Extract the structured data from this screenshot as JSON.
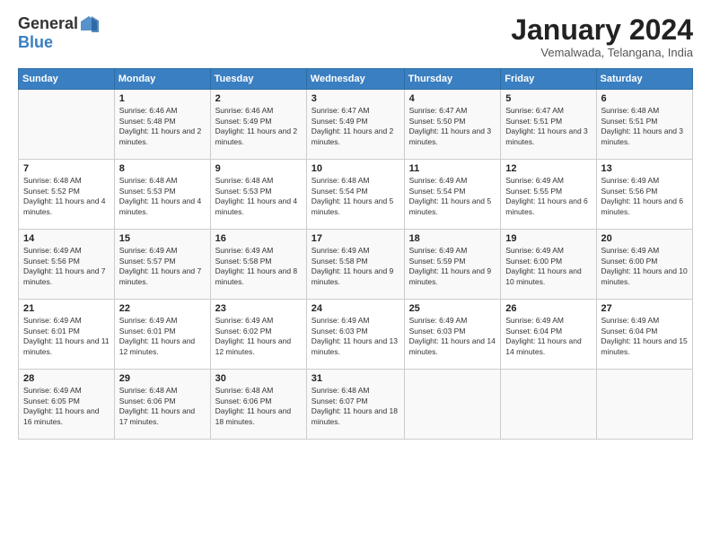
{
  "header": {
    "logo_general": "General",
    "logo_blue": "Blue",
    "month_title": "January 2024",
    "subtitle": "Vemalwada, Telangana, India"
  },
  "columns": [
    "Sunday",
    "Monday",
    "Tuesday",
    "Wednesday",
    "Thursday",
    "Friday",
    "Saturday"
  ],
  "weeks": [
    [
      {
        "day": "",
        "sunrise": "",
        "sunset": "",
        "daylight": ""
      },
      {
        "day": "1",
        "sunrise": "Sunrise: 6:46 AM",
        "sunset": "Sunset: 5:48 PM",
        "daylight": "Daylight: 11 hours and 2 minutes."
      },
      {
        "day": "2",
        "sunrise": "Sunrise: 6:46 AM",
        "sunset": "Sunset: 5:49 PM",
        "daylight": "Daylight: 11 hours and 2 minutes."
      },
      {
        "day": "3",
        "sunrise": "Sunrise: 6:47 AM",
        "sunset": "Sunset: 5:49 PM",
        "daylight": "Daylight: 11 hours and 2 minutes."
      },
      {
        "day": "4",
        "sunrise": "Sunrise: 6:47 AM",
        "sunset": "Sunset: 5:50 PM",
        "daylight": "Daylight: 11 hours and 3 minutes."
      },
      {
        "day": "5",
        "sunrise": "Sunrise: 6:47 AM",
        "sunset": "Sunset: 5:51 PM",
        "daylight": "Daylight: 11 hours and 3 minutes."
      },
      {
        "day": "6",
        "sunrise": "Sunrise: 6:48 AM",
        "sunset": "Sunset: 5:51 PM",
        "daylight": "Daylight: 11 hours and 3 minutes."
      }
    ],
    [
      {
        "day": "7",
        "sunrise": "Sunrise: 6:48 AM",
        "sunset": "Sunset: 5:52 PM",
        "daylight": "Daylight: 11 hours and 4 minutes."
      },
      {
        "day": "8",
        "sunrise": "Sunrise: 6:48 AM",
        "sunset": "Sunset: 5:53 PM",
        "daylight": "Daylight: 11 hours and 4 minutes."
      },
      {
        "day": "9",
        "sunrise": "Sunrise: 6:48 AM",
        "sunset": "Sunset: 5:53 PM",
        "daylight": "Daylight: 11 hours and 4 minutes."
      },
      {
        "day": "10",
        "sunrise": "Sunrise: 6:48 AM",
        "sunset": "Sunset: 5:54 PM",
        "daylight": "Daylight: 11 hours and 5 minutes."
      },
      {
        "day": "11",
        "sunrise": "Sunrise: 6:49 AM",
        "sunset": "Sunset: 5:54 PM",
        "daylight": "Daylight: 11 hours and 5 minutes."
      },
      {
        "day": "12",
        "sunrise": "Sunrise: 6:49 AM",
        "sunset": "Sunset: 5:55 PM",
        "daylight": "Daylight: 11 hours and 6 minutes."
      },
      {
        "day": "13",
        "sunrise": "Sunrise: 6:49 AM",
        "sunset": "Sunset: 5:56 PM",
        "daylight": "Daylight: 11 hours and 6 minutes."
      }
    ],
    [
      {
        "day": "14",
        "sunrise": "Sunrise: 6:49 AM",
        "sunset": "Sunset: 5:56 PM",
        "daylight": "Daylight: 11 hours and 7 minutes."
      },
      {
        "day": "15",
        "sunrise": "Sunrise: 6:49 AM",
        "sunset": "Sunset: 5:57 PM",
        "daylight": "Daylight: 11 hours and 7 minutes."
      },
      {
        "day": "16",
        "sunrise": "Sunrise: 6:49 AM",
        "sunset": "Sunset: 5:58 PM",
        "daylight": "Daylight: 11 hours and 8 minutes."
      },
      {
        "day": "17",
        "sunrise": "Sunrise: 6:49 AM",
        "sunset": "Sunset: 5:58 PM",
        "daylight": "Daylight: 11 hours and 9 minutes."
      },
      {
        "day": "18",
        "sunrise": "Sunrise: 6:49 AM",
        "sunset": "Sunset: 5:59 PM",
        "daylight": "Daylight: 11 hours and 9 minutes."
      },
      {
        "day": "19",
        "sunrise": "Sunrise: 6:49 AM",
        "sunset": "Sunset: 6:00 PM",
        "daylight": "Daylight: 11 hours and 10 minutes."
      },
      {
        "day": "20",
        "sunrise": "Sunrise: 6:49 AM",
        "sunset": "Sunset: 6:00 PM",
        "daylight": "Daylight: 11 hours and 10 minutes."
      }
    ],
    [
      {
        "day": "21",
        "sunrise": "Sunrise: 6:49 AM",
        "sunset": "Sunset: 6:01 PM",
        "daylight": "Daylight: 11 hours and 11 minutes."
      },
      {
        "day": "22",
        "sunrise": "Sunrise: 6:49 AM",
        "sunset": "Sunset: 6:01 PM",
        "daylight": "Daylight: 11 hours and 12 minutes."
      },
      {
        "day": "23",
        "sunrise": "Sunrise: 6:49 AM",
        "sunset": "Sunset: 6:02 PM",
        "daylight": "Daylight: 11 hours and 12 minutes."
      },
      {
        "day": "24",
        "sunrise": "Sunrise: 6:49 AM",
        "sunset": "Sunset: 6:03 PM",
        "daylight": "Daylight: 11 hours and 13 minutes."
      },
      {
        "day": "25",
        "sunrise": "Sunrise: 6:49 AM",
        "sunset": "Sunset: 6:03 PM",
        "daylight": "Daylight: 11 hours and 14 minutes."
      },
      {
        "day": "26",
        "sunrise": "Sunrise: 6:49 AM",
        "sunset": "Sunset: 6:04 PM",
        "daylight": "Daylight: 11 hours and 14 minutes."
      },
      {
        "day": "27",
        "sunrise": "Sunrise: 6:49 AM",
        "sunset": "Sunset: 6:04 PM",
        "daylight": "Daylight: 11 hours and 15 minutes."
      }
    ],
    [
      {
        "day": "28",
        "sunrise": "Sunrise: 6:49 AM",
        "sunset": "Sunset: 6:05 PM",
        "daylight": "Daylight: 11 hours and 16 minutes."
      },
      {
        "day": "29",
        "sunrise": "Sunrise: 6:48 AM",
        "sunset": "Sunset: 6:06 PM",
        "daylight": "Daylight: 11 hours and 17 minutes."
      },
      {
        "day": "30",
        "sunrise": "Sunrise: 6:48 AM",
        "sunset": "Sunset: 6:06 PM",
        "daylight": "Daylight: 11 hours and 18 minutes."
      },
      {
        "day": "31",
        "sunrise": "Sunrise: 6:48 AM",
        "sunset": "Sunset: 6:07 PM",
        "daylight": "Daylight: 11 hours and 18 minutes."
      },
      {
        "day": "",
        "sunrise": "",
        "sunset": "",
        "daylight": ""
      },
      {
        "day": "",
        "sunrise": "",
        "sunset": "",
        "daylight": ""
      },
      {
        "day": "",
        "sunrise": "",
        "sunset": "",
        "daylight": ""
      }
    ]
  ]
}
